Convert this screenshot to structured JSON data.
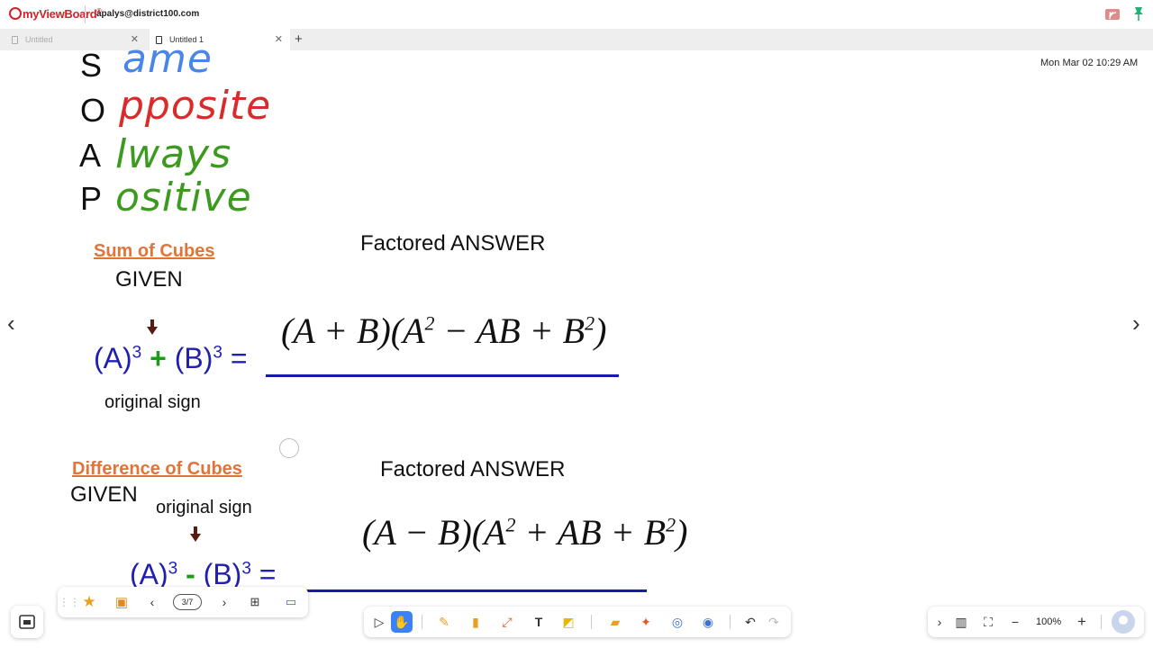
{
  "app": {
    "brand": "myViewBoard",
    "account": "apalys@district100.com",
    "datetime": "Mon Mar 02 10:29 AM"
  },
  "tabs": [
    {
      "label": "Untitled",
      "active": false
    },
    {
      "label": "Untitled 1",
      "active": true
    }
  ],
  "soap": [
    {
      "letter": "S",
      "rest": "ame",
      "color": "#4a86e8"
    },
    {
      "letter": "O",
      "rest": "pposite",
      "color": "#d92b2b"
    },
    {
      "letter": "A",
      "rest": "lways",
      "color": "#3c9a1e"
    },
    {
      "letter": "P",
      "rest": "ositive",
      "color": "#3c9a1e"
    }
  ],
  "sum": {
    "heading": "Sum of Cubes",
    "given": "GIVEN",
    "factored_heading": "Factored ANSWER",
    "expr": {
      "a": "(A)",
      "exp": "3",
      "op": "+",
      "b": "(B)",
      "exp2": "3",
      "eq": "="
    },
    "note": "original sign",
    "formula": {
      "p1": "(A + B)(A",
      "e1": "2",
      "p2": " − AB + B",
      "e2": "2",
      "p3": ")"
    }
  },
  "diff": {
    "heading": "Difference of Cubes",
    "given": "GIVEN",
    "factored_heading": "Factored ANSWER",
    "expr": {
      "a": "(A)",
      "exp": "3",
      "op": "-",
      "b": "(B)",
      "exp2": "3",
      "eq": "="
    },
    "note": "original sign",
    "formula": {
      "p1": "(A − B)(A",
      "e1": "2",
      "p2": " + AB + B",
      "e2": "2",
      "p3": ")"
    }
  },
  "page_nav": {
    "page": "3/7"
  },
  "zoom": {
    "level": "100%"
  },
  "colors": {
    "accent": "#3b82f6",
    "heading": "#e0743a",
    "expr": "#1f1fb0",
    "op": "#1a9c1a",
    "line": "#1a1aa8"
  }
}
